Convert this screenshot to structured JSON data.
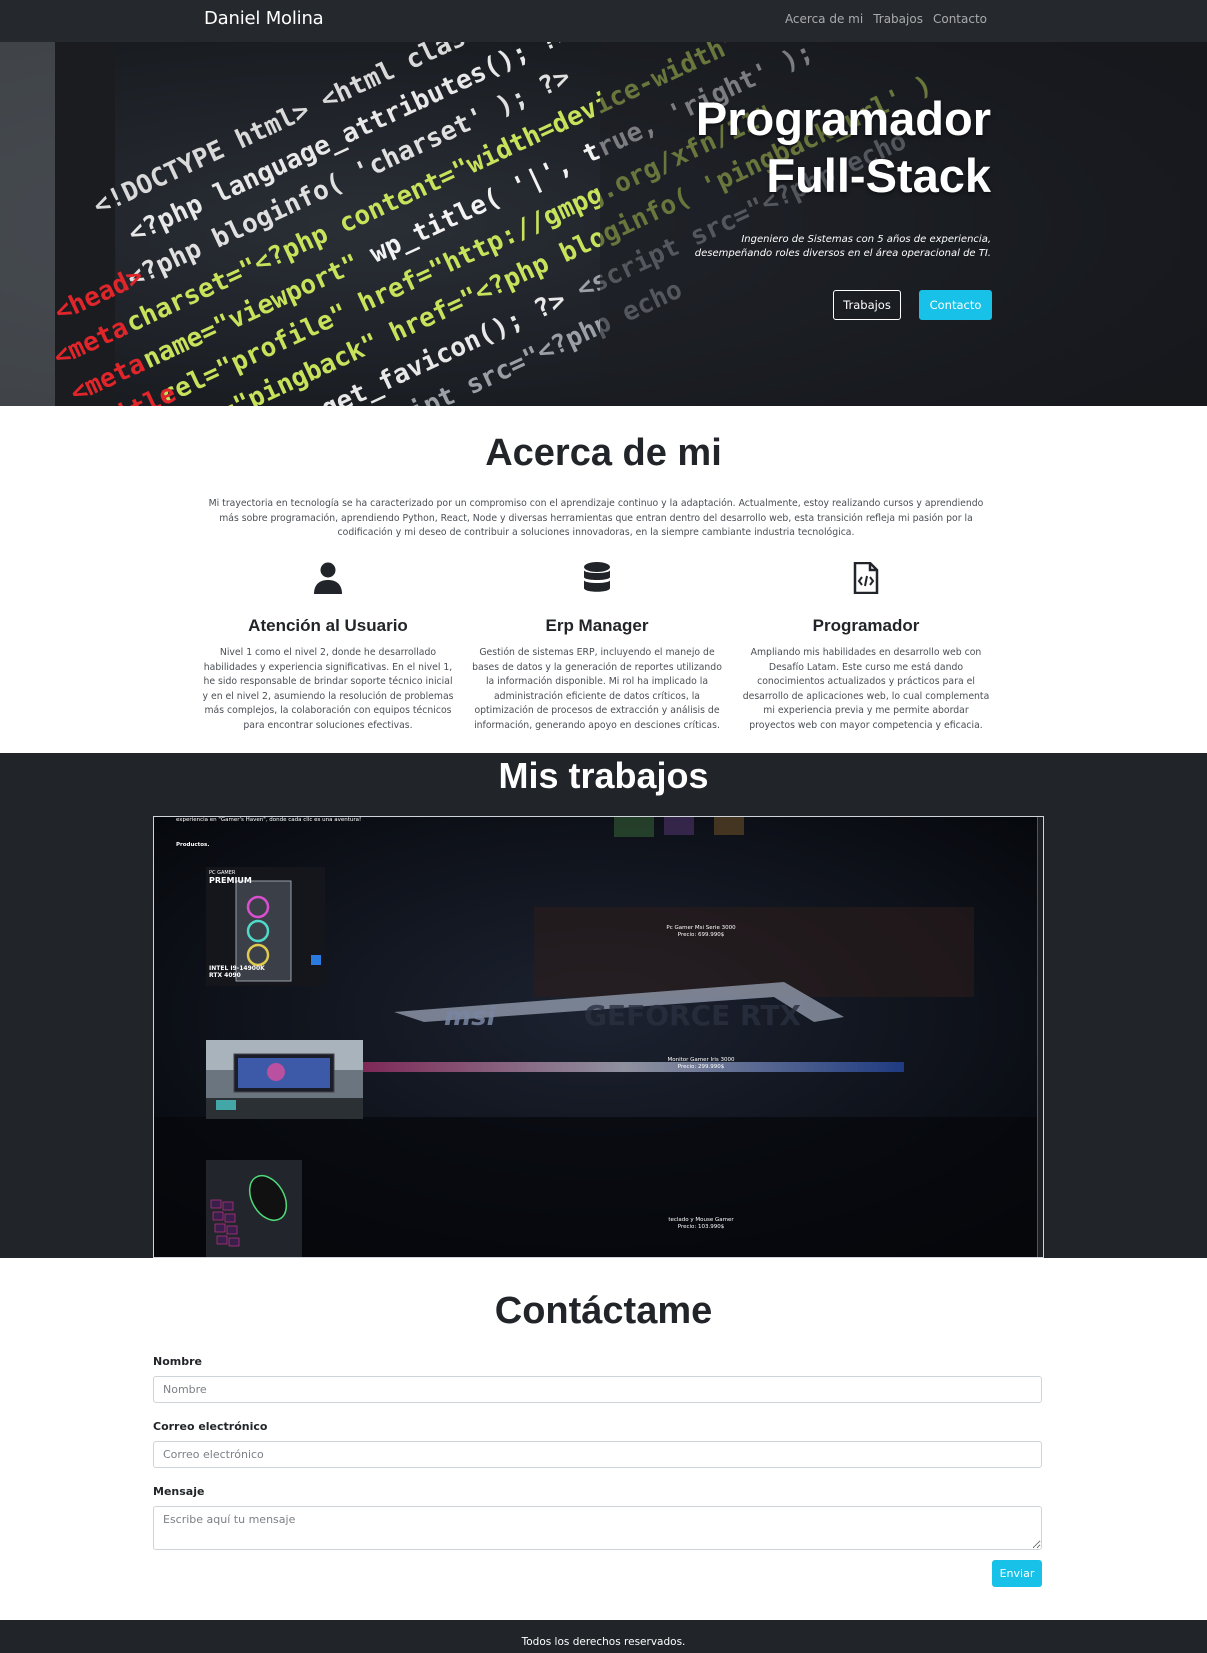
{
  "navbar": {
    "brand": "Daniel Molina",
    "links": [
      "Acerca de mi",
      "Trabajos",
      "Contacto"
    ]
  },
  "hero": {
    "title_line1": "Programador",
    "title_line2": "Full-Stack",
    "subtitle_line1": "Ingeniero de Sistemas con 5 años de experiencia,",
    "subtitle_line2": "desempeñando roles diversos en el área operacional de TI.",
    "btn_works": "Trabajos",
    "btn_contact": "Contacto",
    "background": "code-editor-photo"
  },
  "about": {
    "title": "Acerca de mi",
    "text": "Mi trayectoria en tecnología se ha caracterizado por un compromiso con el aprendizaje continuo y la adaptación. Actualmente, estoy realizando cursos y aprendiendo más sobre programación, aprendiendo Python, React, Node y diversas herramientas que entran dentro del desarrollo web, esta transición refleja mi pasión por la codificación y mi deseo de contribuir a soluciones innovadoras, en la siempre cambiante industria tecnológica.",
    "features": [
      {
        "icon": "user-icon",
        "title": "Atención al Usuario",
        "text": "Nivel 1 como el nivel 2, donde he desarrollado habilidades y experiencia significativas. En el nivel 1, he sido responsable de brindar soporte técnico inicial y en el nivel 2, asumiendo la resolución de problemas más complejos, la colaboración con equipos técnicos para encontrar soluciones efectivas."
      },
      {
        "icon": "database-icon",
        "title": "Erp Manager",
        "text": "Gestión de sistemas ERP, incluyendo el manejo de bases de datos y la generación de reportes utilizando la información disponible. Mi rol ha implicado la administración eficiente de datos críticos, la optimización de procesos de extracción y análisis de información, generando apoyo en desciones críticas."
      },
      {
        "icon": "file-code-icon",
        "title": "Programador",
        "text": "Ampliando mis habilidades en desarrollo web con Desafío Latam. Este curso me está dando conocimientos actualizados y prácticos para el desarrollo de aplicaciones web, lo cual complementa mi experiencia previa y me permite abordar proyectos web con mayor competencia y eficacia."
      }
    ]
  },
  "works": {
    "title": "Mis trabajos",
    "embed_intro": "experiencia en \"Gamer's Haven\", donde cada clic es una aventura!",
    "embed_heading": "Productos.",
    "pc_box_line1": "PC GAMER",
    "pc_box_line2": "PREMIUM",
    "pc_box_spec1": "INTEL I9-14900K",
    "pc_box_spec2": "RTX 4090",
    "products": [
      {
        "name": "Pc Gamer Msi Serie 3000",
        "price": "Precio: 699.990$"
      },
      {
        "name": "Monitor Gamer Iris 3000",
        "price": "Precio: 299.990$"
      },
      {
        "name": "teclado y Mouse Gamer",
        "price": "Precio: 103.990$"
      }
    ],
    "backdrop_brand": "msi",
    "backdrop_text": "GEFORCE RTX"
  },
  "contact": {
    "title": "Contáctame",
    "name_label": "Nombre",
    "name_placeholder": "Nombre",
    "email_label": "Correo electrónico",
    "email_placeholder": "Correo electrónico",
    "message_label": "Mensaje",
    "message_placeholder": "Escribe aquí tu mensaje",
    "submit": "Enviar"
  },
  "footer": {
    "text": "Todos los derechos reservados."
  },
  "colors": {
    "dark": "#212529",
    "navbar": "#25282c",
    "accent": "#17c1e8",
    "white": "#ffffff"
  }
}
